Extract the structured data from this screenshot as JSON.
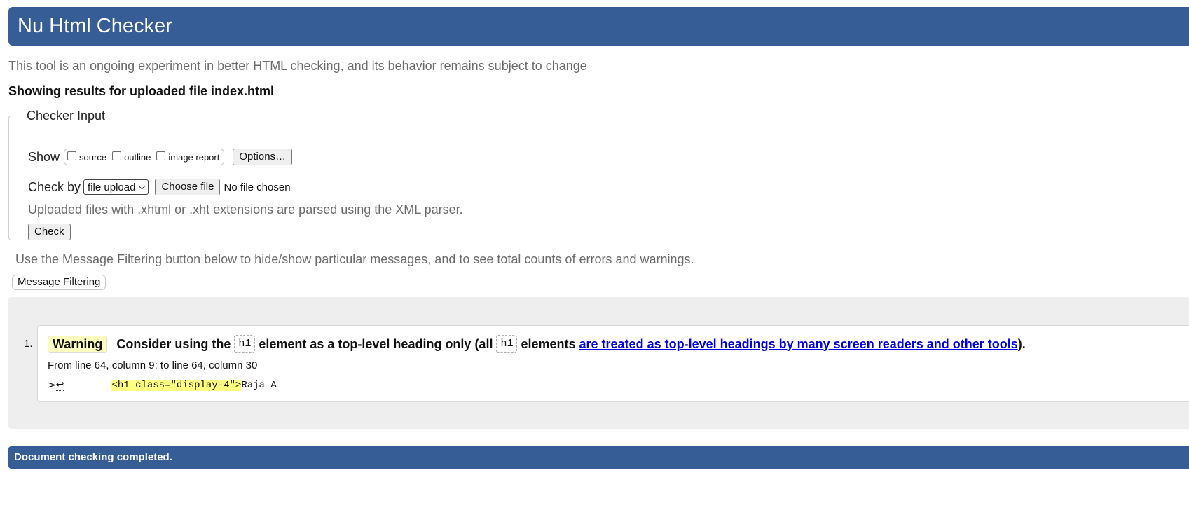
{
  "header": {
    "title": "Nu Html Checker"
  },
  "intro_text": "This tool is an ongoing experiment in better HTML checking, and its behavior remains subject to change",
  "results_heading": "Showing results for uploaded file index.html",
  "checker_input": {
    "legend": "Checker Input",
    "show_label": "Show",
    "options": [
      {
        "label": "source",
        "checked": false
      },
      {
        "label": "outline",
        "checked": false
      },
      {
        "label": "image report",
        "checked": false
      }
    ],
    "options_button": "Options…",
    "check_by_label": "Check by",
    "check_by_value": "file upload",
    "choose_file_button": "Choose file",
    "no_file_text": "No file chosen",
    "note": "Uploaded files with .xhtml or .xht extensions are parsed using the XML parser.",
    "check_button": "Check"
  },
  "filter": {
    "note": "Use the Message Filtering button below to hide/show particular messages, and to see total counts of errors and warnings.",
    "button": "Message Filtering"
  },
  "messages": [
    {
      "number": "1.",
      "type": "Warning",
      "text_1": "Consider using the",
      "code_1": "h1",
      "text_2": "element as a top-level heading only (all",
      "code_2": "h1",
      "text_3": "elements",
      "link_text": "are treated as top-level headings by many screen readers and other tools",
      "text_4": ").",
      "location": "From line 64, column 9; to line 64, column 30",
      "extract_prefix": ">",
      "extract_return": "↩",
      "extract_highlight": "<h1 class=\"display-4\">",
      "extract_suffix": "Raja A"
    }
  ],
  "footer": {
    "status": "Document checking completed."
  },
  "colors": {
    "header_bg": "#365d95",
    "warning_badge_bg": "#ffffbf",
    "highlight_bg": "#ffff80",
    "results_bg": "#eeeeee",
    "link": "#0000ee"
  }
}
